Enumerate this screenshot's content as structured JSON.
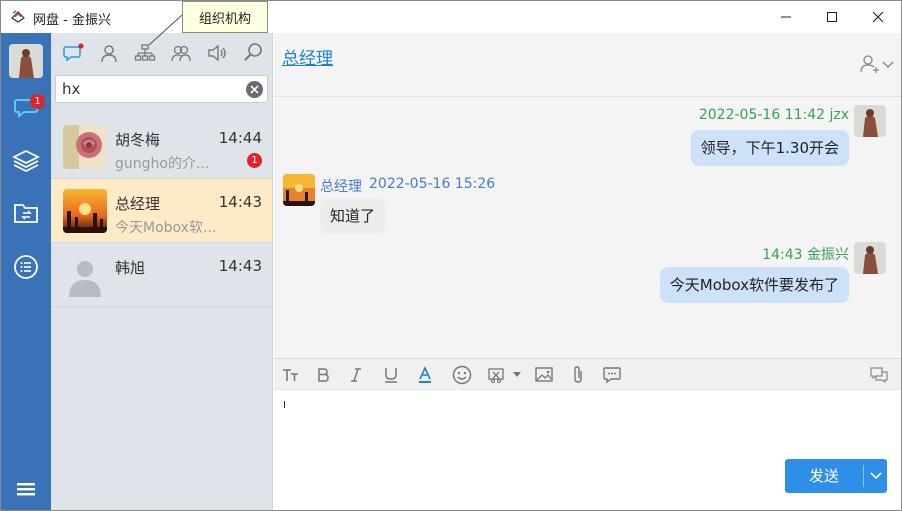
{
  "window": {
    "title": "网盘 - 金振兴",
    "tooltip": "组织机构"
  },
  "rail": {
    "chat_badge": "1"
  },
  "search": {
    "value": "hx"
  },
  "contacts": [
    {
      "name": "胡冬梅",
      "time": "14:44",
      "preview": "gungho的介...",
      "badge": "1"
    },
    {
      "name": "总经理",
      "time": "14:43",
      "preview": "今天Mobox软..."
    },
    {
      "name": "韩旭",
      "time": "14:43",
      "preview": ""
    }
  ],
  "chat": {
    "title": "总经理",
    "messages": [
      {
        "meta": "2022-05-16 11:42 jzx",
        "text": "领导，下午1.30开会",
        "mine": true
      },
      {
        "sender": "总经理",
        "time": "2022-05-16 15:26",
        "text": "知道了",
        "mine": false
      },
      {
        "meta": "14:43 金振兴",
        "text": "今天Mobox软件要发布了",
        "mine": true
      }
    ]
  },
  "compose": {
    "send_label": "发送"
  },
  "colors": {
    "rail": "#3a72b8",
    "accent": "#1e7fd6",
    "own_meta": "#3aa05a",
    "peer_meta": "#4a7bd0",
    "active_contact": "#fdebc8",
    "my_bubble": "#cde1f9",
    "send_button": "#2f8ee6"
  }
}
